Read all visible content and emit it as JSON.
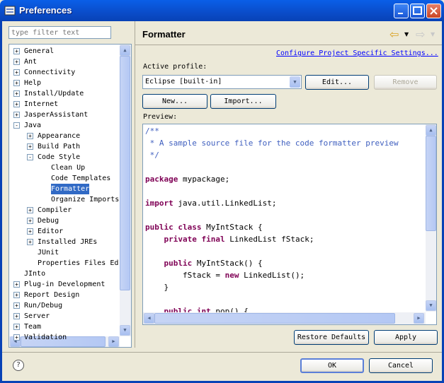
{
  "window": {
    "title": "Preferences"
  },
  "filter": {
    "placeholder": "type filter text"
  },
  "tree": [
    {
      "label": "General",
      "depth": 0,
      "exp": "+"
    },
    {
      "label": "Ant",
      "depth": 0,
      "exp": "+"
    },
    {
      "label": "Connectivity",
      "depth": 0,
      "exp": "+"
    },
    {
      "label": "Help",
      "depth": 0,
      "exp": "+"
    },
    {
      "label": "Install/Update",
      "depth": 0,
      "exp": "+"
    },
    {
      "label": "Internet",
      "depth": 0,
      "exp": "+"
    },
    {
      "label": "JasperAssistant",
      "depth": 0,
      "exp": "+"
    },
    {
      "label": "Java",
      "depth": 0,
      "exp": "-"
    },
    {
      "label": "Appearance",
      "depth": 1,
      "exp": "+"
    },
    {
      "label": "Build Path",
      "depth": 1,
      "exp": "+"
    },
    {
      "label": "Code Style",
      "depth": 1,
      "exp": "-"
    },
    {
      "label": "Clean Up",
      "depth": 2,
      "exp": ""
    },
    {
      "label": "Code Templates",
      "depth": 2,
      "exp": ""
    },
    {
      "label": "Formatter",
      "depth": 2,
      "exp": "",
      "selected": true
    },
    {
      "label": "Organize Imports",
      "depth": 2,
      "exp": ""
    },
    {
      "label": "Compiler",
      "depth": 1,
      "exp": "+"
    },
    {
      "label": "Debug",
      "depth": 1,
      "exp": "+"
    },
    {
      "label": "Editor",
      "depth": 1,
      "exp": "+"
    },
    {
      "label": "Installed JREs",
      "depth": 1,
      "exp": "+"
    },
    {
      "label": "JUnit",
      "depth": 1,
      "exp": ""
    },
    {
      "label": "Properties Files Ed",
      "depth": 1,
      "exp": ""
    },
    {
      "label": "JInto",
      "depth": 0,
      "exp": ""
    },
    {
      "label": "Plug-in Development",
      "depth": 0,
      "exp": "+"
    },
    {
      "label": "Report Design",
      "depth": 0,
      "exp": "+"
    },
    {
      "label": "Run/Debug",
      "depth": 0,
      "exp": "+"
    },
    {
      "label": "Server",
      "depth": 0,
      "exp": "+"
    },
    {
      "label": "Team",
      "depth": 0,
      "exp": "+"
    },
    {
      "label": "Validation",
      "depth": 0,
      "exp": "+"
    }
  ],
  "page": {
    "title": "Formatter",
    "configure_link": "Configure Project Specific Settings...",
    "active_profile_label": "Active profile:",
    "profile_value": "Eclipse [built-in]",
    "edit_label": "Edit...",
    "remove_label": "Remove",
    "new_label": "New...",
    "import_label": "Import...",
    "preview_label": "Preview:",
    "restore_label": "Restore Defaults",
    "apply_label": "Apply"
  },
  "code": [
    [
      [
        "comment",
        "/**"
      ]
    ],
    [
      [
        "comment",
        " * A sample source file for the code formatter preview"
      ]
    ],
    [
      [
        "comment",
        " */"
      ]
    ],
    [],
    [
      [
        "kw",
        "package"
      ],
      [
        "plain",
        " mypackage;"
      ]
    ],
    [],
    [
      [
        "kw",
        "import"
      ],
      [
        "plain",
        " java.util.LinkedList;"
      ]
    ],
    [],
    [
      [
        "kw",
        "public"
      ],
      [
        "plain",
        " "
      ],
      [
        "kw",
        "class"
      ],
      [
        "plain",
        " MyIntStack {"
      ]
    ],
    [
      [
        "plain",
        "    "
      ],
      [
        "kw",
        "private"
      ],
      [
        "plain",
        " "
      ],
      [
        "kw",
        "final"
      ],
      [
        "plain",
        " LinkedList fStack;"
      ]
    ],
    [],
    [
      [
        "plain",
        "    "
      ],
      [
        "kw",
        "public"
      ],
      [
        "plain",
        " MyIntStack() {"
      ]
    ],
    [
      [
        "plain",
        "        fStack = "
      ],
      [
        "kw",
        "new"
      ],
      [
        "plain",
        " LinkedList();"
      ]
    ],
    [
      [
        "plain",
        "    }"
      ]
    ],
    [],
    [
      [
        "plain",
        "    "
      ],
      [
        "kw",
        "public"
      ],
      [
        "plain",
        " "
      ],
      [
        "kw",
        "int"
      ],
      [
        "plain",
        " pop() {"
      ]
    ]
  ],
  "dialog": {
    "ok_label": "OK",
    "cancel_label": "Cancel"
  }
}
